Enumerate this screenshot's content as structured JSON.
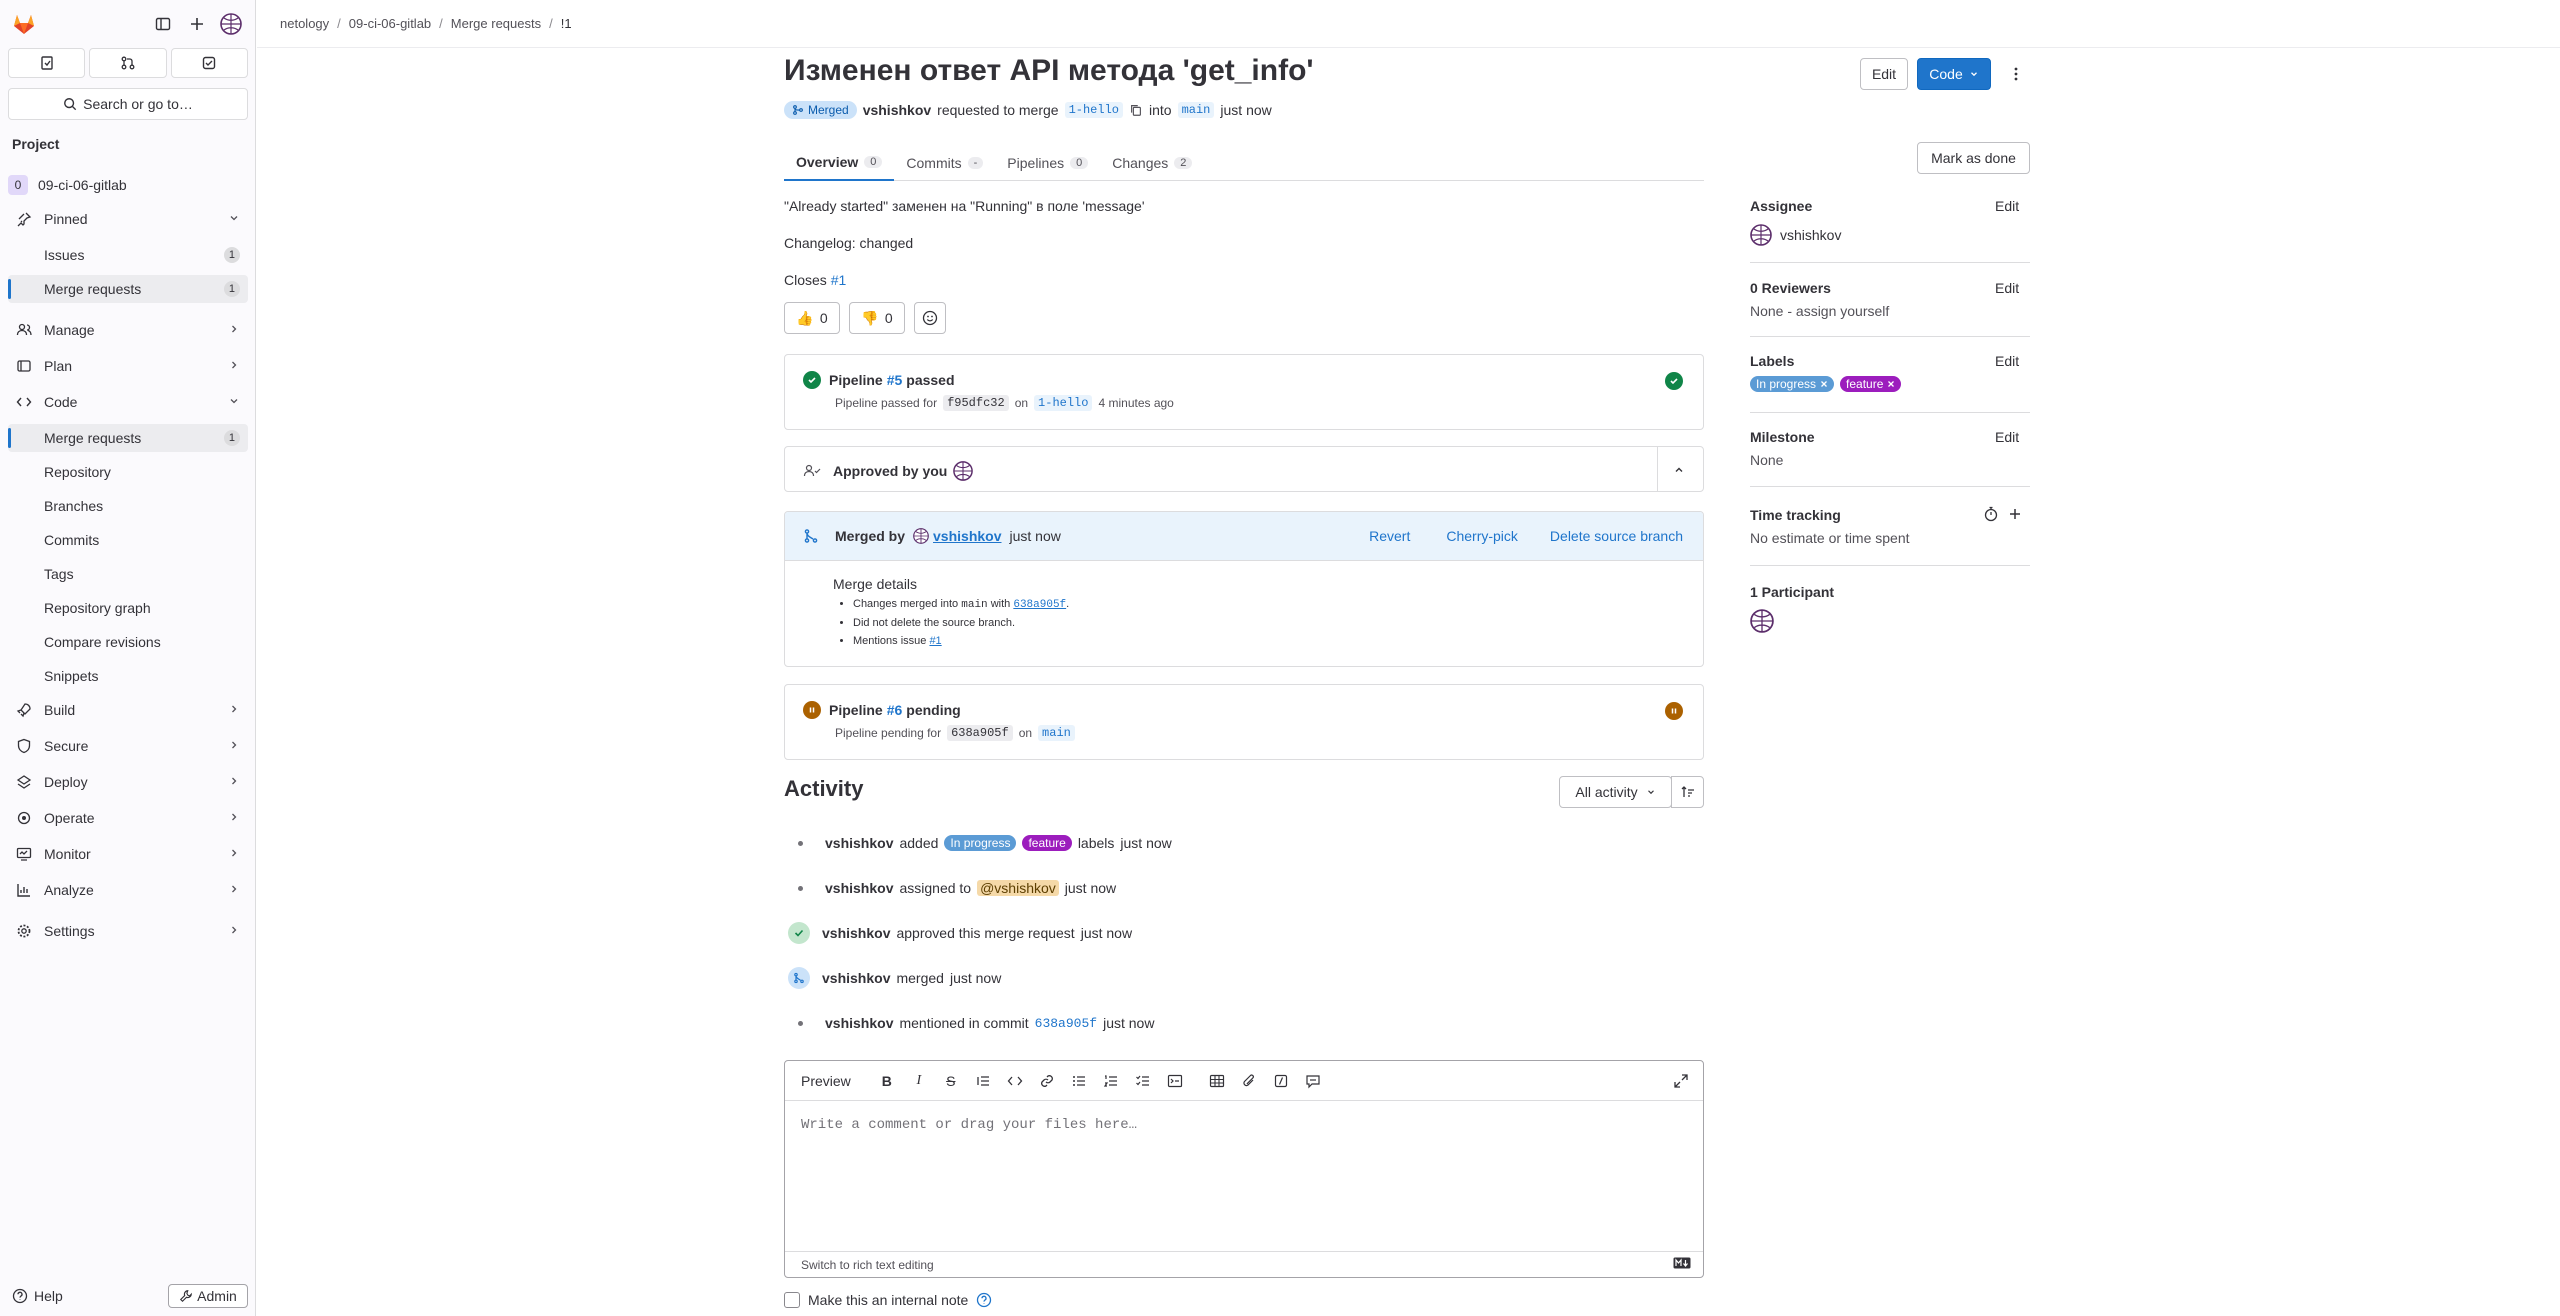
{
  "sidebar": {
    "project_heading": "Project",
    "project_avatar_letter": "0",
    "project_name": "09-ci-06-gitlab",
    "search_label": "Search or go to…",
    "items": [
      {
        "label": "Pinned"
      },
      {
        "label": "Issues",
        "count": "1"
      },
      {
        "label": "Merge requests",
        "count": "1"
      },
      {
        "label": "Manage"
      },
      {
        "label": "Plan"
      },
      {
        "label": "Code"
      },
      {
        "label": "Merge requests",
        "count": "1"
      },
      {
        "label": "Repository"
      },
      {
        "label": "Branches"
      },
      {
        "label": "Commits"
      },
      {
        "label": "Tags"
      },
      {
        "label": "Repository graph"
      },
      {
        "label": "Compare revisions"
      },
      {
        "label": "Snippets"
      },
      {
        "label": "Build"
      },
      {
        "label": "Secure"
      },
      {
        "label": "Deploy"
      },
      {
        "label": "Operate"
      },
      {
        "label": "Monitor"
      },
      {
        "label": "Analyze"
      },
      {
        "label": "Settings"
      }
    ],
    "help_label": "Help",
    "admin_label": "Admin"
  },
  "breadcrumb": [
    "netology",
    "09-ci-06-gitlab",
    "Merge requests",
    "!1"
  ],
  "header": {
    "title": "Изменен ответ API метода 'get_info'",
    "edit_label": "Edit",
    "code_label": "Code",
    "status": "Merged",
    "author": "vshishkov",
    "requested_text": "requested to merge",
    "source_branch": "1-hello",
    "into_text": "into",
    "target_branch": "main",
    "time": "just now"
  },
  "tabs": [
    {
      "label": "Overview",
      "count": "0"
    },
    {
      "label": "Commits",
      "count": "-"
    },
    {
      "label": "Pipelines",
      "count": "0"
    },
    {
      "label": "Changes",
      "count": "2"
    }
  ],
  "mark_done_label": "Mark as done",
  "description": {
    "line1": "\"Already started\" заменен на \"Running\" в поле 'message'",
    "line2": "Changelog: changed",
    "closes_text": "Closes",
    "closes_ref": "#1"
  },
  "reactions": {
    "thumbsup": "0",
    "thumbsdown": "0"
  },
  "pipeline5": {
    "prefix": "Pipeline",
    "ref": "#5",
    "status": "passed",
    "sub_prefix": "Pipeline passed for",
    "commit": "f95dfc32",
    "on": "on",
    "branch": "1-hello",
    "time": "4 minutes ago"
  },
  "approval": {
    "text": "Approved by you"
  },
  "merged": {
    "prefix": "Merged by",
    "user": "vshishkov",
    "time": "just now",
    "revert": "Revert",
    "cherry_pick": "Cherry-pick",
    "delete_branch": "Delete source branch",
    "details_title": "Merge details",
    "detail1_a": "Changes merged into",
    "detail1_branch": "main",
    "detail1_b": "with",
    "detail1_commit": "638a905f",
    "detail2": "Did not delete the source branch.",
    "detail3_a": "Mentions issue",
    "detail3_ref": "#1"
  },
  "pipeline6": {
    "prefix": "Pipeline",
    "ref": "#6",
    "status": "pending",
    "sub_prefix": "Pipeline pending for",
    "commit": "638a905f",
    "on": "on",
    "branch": "main"
  },
  "activity": {
    "heading": "Activity",
    "filter_label": "All activity",
    "items": [
      {
        "user": "vshishkov",
        "a": "added",
        "label1": "In progress",
        "label2": "feature",
        "b": "labels",
        "time": "just now"
      },
      {
        "user": "vshishkov",
        "a": "assigned to",
        "mention": "@vshishkov",
        "time": "just now"
      },
      {
        "user": "vshishkov",
        "a": "approved this merge request",
        "time": "just now"
      },
      {
        "user": "vshishkov",
        "a": "merged",
        "time": "just now"
      },
      {
        "user": "vshishkov",
        "a": "mentioned in commit",
        "commit": "638a905f",
        "time": "just now"
      }
    ]
  },
  "editor": {
    "preview_label": "Preview",
    "placeholder": "Write a comment or drag your files here…",
    "switch_label": "Switch to rich text editing",
    "internal_note": "Make this an internal note"
  },
  "right": {
    "assignee_title": "Assignee",
    "assignee_name": "vshishkov",
    "reviewers_title": "0 Reviewers",
    "reviewers_val": "None - assign yourself",
    "labels_title": "Labels",
    "label1": "In progress",
    "label2": "feature",
    "milestone_title": "Milestone",
    "milestone_val": "None",
    "time_title": "Time tracking",
    "time_val": "No estimate or time spent",
    "participants_title": "1 Participant",
    "edit": "Edit"
  },
  "colors": {
    "accent": "#1f75cb",
    "success": "#108548",
    "pending": "#ab6100",
    "label_blue": "#5b9bd5",
    "label_purple": "#9c1dbd"
  }
}
